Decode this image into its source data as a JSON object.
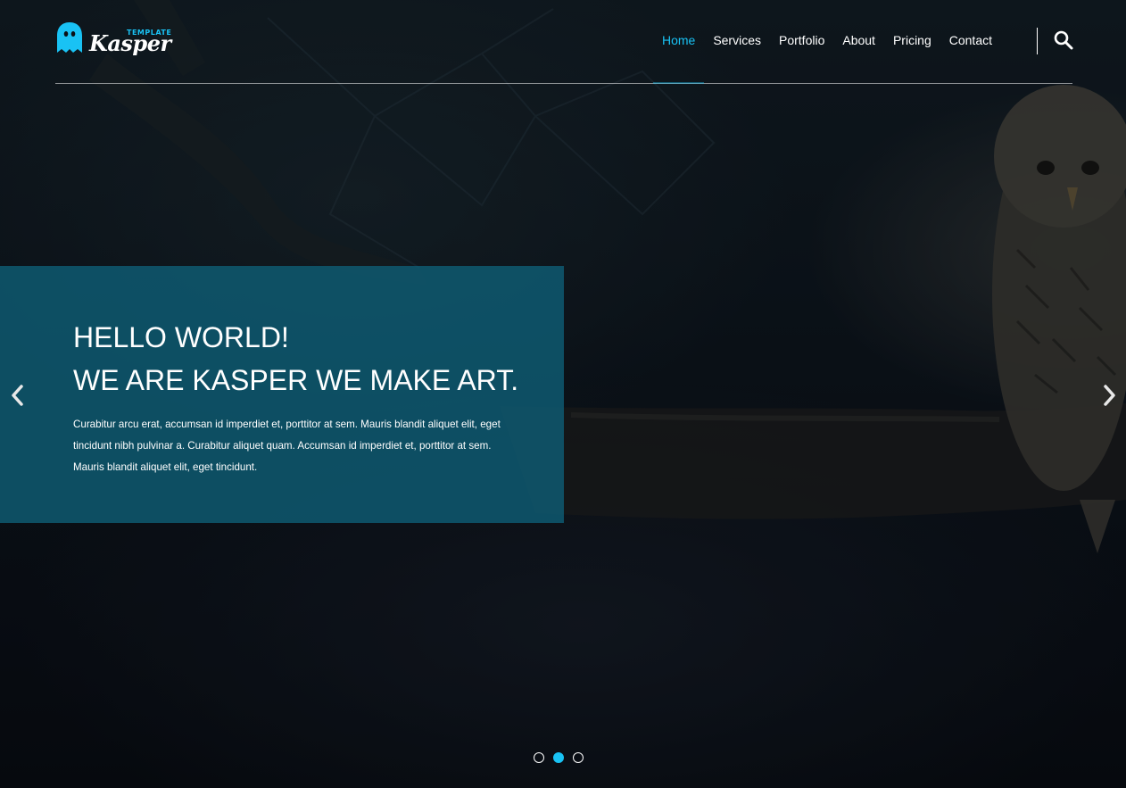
{
  "colors": {
    "accent": "#19c2f4",
    "panel": "#0e6079",
    "text": "#ffffff"
  },
  "logo": {
    "small_text": "TEMPLATE",
    "main_text": "Kasper",
    "icon": "ghost-icon"
  },
  "nav": {
    "items": [
      {
        "label": "Home",
        "active": true
      },
      {
        "label": "Services",
        "active": false
      },
      {
        "label": "Portfolio",
        "active": false
      },
      {
        "label": "About",
        "active": false
      },
      {
        "label": "Pricing",
        "active": false
      },
      {
        "label": "Contact",
        "active": false
      }
    ],
    "search_icon": "search-icon"
  },
  "slider": {
    "title_line1": "HELLO WORLD!",
    "title_line2": "WE ARE KASPER WE MAKE ART.",
    "text": "Curabitur arcu erat, accumsan id imperdiet et, porttitor at sem. Mauris blandit aliquet elit, eget tincidunt nibh pulvinar a. Curabitur aliquet quam. Accumsan id imperdiet et, porttitor at sem. Mauris blandit aliquet elit, eget tincidunt.",
    "prev_icon": "chevron-left-icon",
    "next_icon": "chevron-right-icon",
    "bullets": [
      {
        "active": false
      },
      {
        "active": true
      },
      {
        "active": false
      }
    ]
  }
}
